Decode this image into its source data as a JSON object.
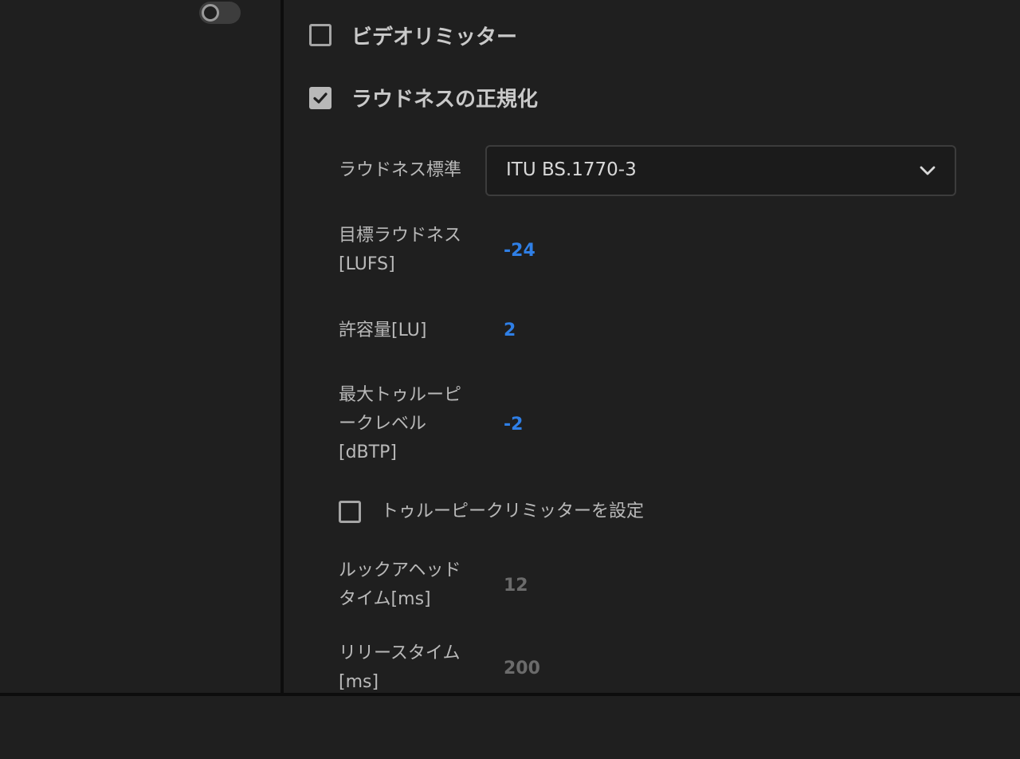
{
  "sidebar": {
    "toggle": {
      "state": "off"
    }
  },
  "main": {
    "video_limiter": {
      "label": "ビデオリミッター",
      "checked": false
    },
    "loudness_normalization": {
      "label": "ラウドネスの正規化",
      "checked": true
    },
    "loudness_standard": {
      "label": "ラウドネス標準",
      "value": "ITU BS.1770-3"
    },
    "target_loudness": {
      "label": "目標ラウドネス\n[LUFS]",
      "value": "-24"
    },
    "tolerance": {
      "label": "許容量[LU]",
      "value": "2"
    },
    "max_true_peak": {
      "label": "最大トゥルーピ\nークレベル\n[dBTP]",
      "value": "-2"
    },
    "true_peak_limiter": {
      "label": "トゥルーピークリミッターを設定",
      "checked": false
    },
    "lookahead_time": {
      "label": "ルックアヘッド\nタイム[ms]",
      "value": "12"
    },
    "release_time": {
      "label": "リリースタイム\n[ms]",
      "value": "200"
    }
  },
  "colors": {
    "background": "#1f1f1f",
    "divider": "#0d0d0d",
    "accent_value": "#2f7fe6",
    "disabled_value": "#6b6b6b"
  }
}
